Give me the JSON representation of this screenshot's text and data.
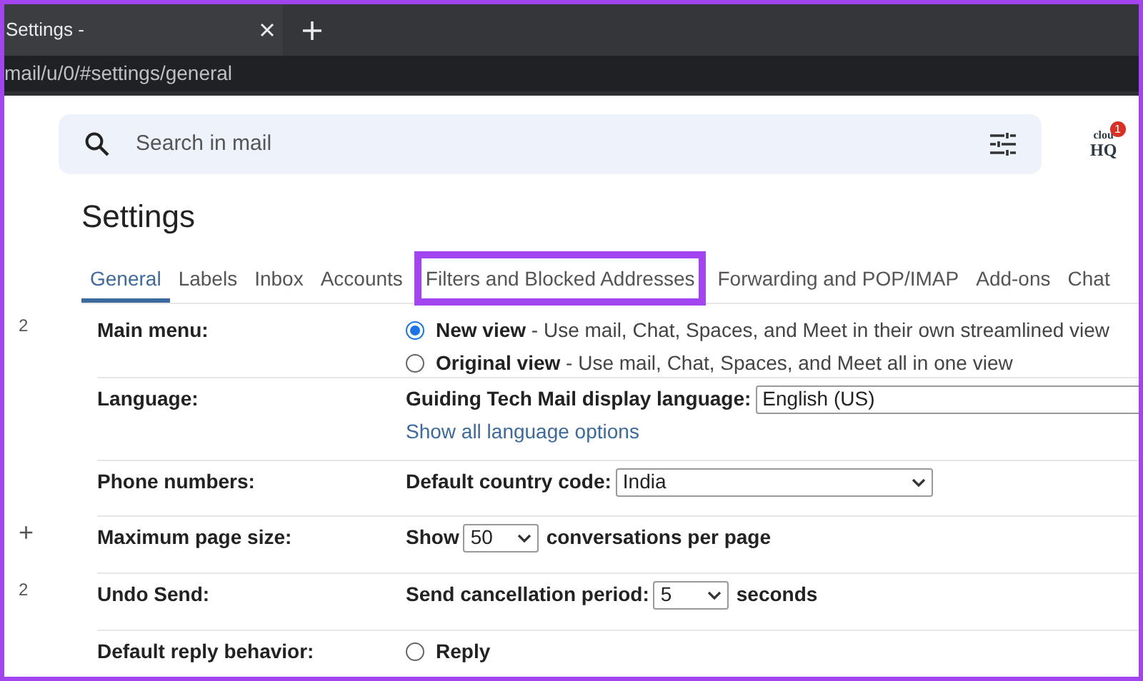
{
  "browser": {
    "tab_title": "Settings -",
    "url": "mail/u/0/#settings/general"
  },
  "search": {
    "placeholder": "Search in mail"
  },
  "badge": {
    "logo_top": "clou",
    "logo_bottom": "HQ",
    "count": "1"
  },
  "title": "Settings",
  "tabs": [
    {
      "label": "General",
      "selected": true,
      "highlighted": false
    },
    {
      "label": "Labels",
      "selected": false,
      "highlighted": false
    },
    {
      "label": "Inbox",
      "selected": false,
      "highlighted": false
    },
    {
      "label": "Accounts",
      "selected": false,
      "highlighted": false
    },
    {
      "label": "Filters and Blocked Addresses",
      "selected": false,
      "highlighted": true
    },
    {
      "label": "Forwarding and POP/IMAP",
      "selected": false,
      "highlighted": false
    },
    {
      "label": "Add-ons",
      "selected": false,
      "highlighted": false
    },
    {
      "label": "Chat",
      "selected": false,
      "highlighted": false
    }
  ],
  "rows": [
    {
      "kind": "radio",
      "gutter": "2",
      "label": "Main menu:",
      "options": [
        {
          "label": "New view",
          "description": "- Use mail, Chat, Spaces, and Meet in their own streamlined view",
          "selected": true
        },
        {
          "label": "Original view",
          "description": "- Use mail, Chat, Spaces, and Meet all in one view",
          "selected": false
        }
      ]
    },
    {
      "kind": "select",
      "label": "Language:",
      "before": "Guiding Tech Mail display language:",
      "value": "English (US)",
      "link": "Show all language options"
    },
    {
      "kind": "select",
      "label": "Phone numbers:",
      "before": "Default country code:",
      "value": "India"
    },
    {
      "kind": "select",
      "gutter": "+",
      "label": "Maximum page size:",
      "before": "Show",
      "value": "50",
      "after": "conversations per page"
    },
    {
      "kind": "select",
      "gutter": "2",
      "label": "Undo Send:",
      "before": "Send cancellation period:",
      "value": "5",
      "after": "seconds"
    },
    {
      "kind": "radio",
      "label": "Default reply behavior:",
      "options": [
        {
          "label": "Reply",
          "selected": false
        }
      ]
    }
  ]
}
